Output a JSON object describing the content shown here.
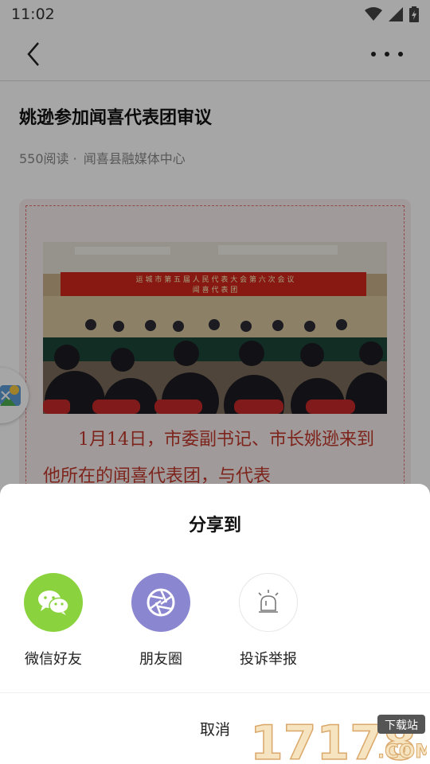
{
  "status": {
    "time": "11:02"
  },
  "article": {
    "title": "姚逊参加闻喜代表团审议",
    "read_count": "550阅读 ·",
    "source": "闻喜县融媒体中心",
    "banner_line1": "运 城 市 第 五 届 人 民 代 表 大 会 第 六 次 会 议",
    "banner_line2": "闻 喜 代 表 团",
    "body_text": "1月14日，市委副书记、市长姚逊来到他所在的闻喜代表团，与代表"
  },
  "share_sheet": {
    "title": "分享到",
    "options": [
      {
        "label": "微信好友",
        "icon": "wechat-icon",
        "color": "#8bd33e"
      },
      {
        "label": "朋友圈",
        "icon": "moments-icon",
        "color": "#8a86d0"
      },
      {
        "label": "投诉举报",
        "icon": "alarm-icon",
        "color": "#ffffff"
      }
    ],
    "cancel_label": "取消"
  },
  "watermark": {
    "number": "17178",
    "tag": "下载站",
    "domain": ".COM"
  }
}
